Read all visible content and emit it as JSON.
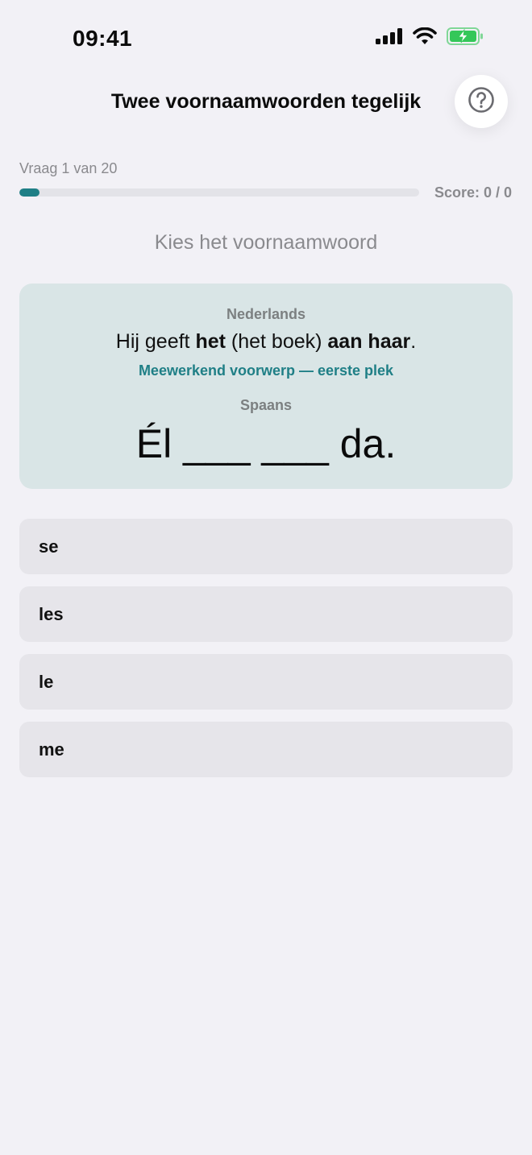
{
  "status_bar": {
    "time": "09:41",
    "icons": [
      "cellular-signal-icon",
      "wifi-icon",
      "battery-charging-icon"
    ],
    "battery_color": "#34c759"
  },
  "header": {
    "title": "Twee voornaamwoorden tegelijk",
    "help_icon": "question-mark-icon"
  },
  "progress": {
    "label": "Vraag 1 van 20",
    "fraction": 0.05,
    "score": "Score: 0 / 0"
  },
  "instruction": "Kies het voornaamwoord",
  "card": {
    "source_language": "Nederlands",
    "source_sentence": {
      "p1": "Hij geeft ",
      "b1": "het",
      "p2": " (het boek) ",
      "b2": "aan haar",
      "p3": "."
    },
    "hint": "Meewerkend voorwerp — eerste plek",
    "target_language": "Spaans",
    "target_sentence": "Él ___ ___ da."
  },
  "options": [
    {
      "label": "se"
    },
    {
      "label": "les"
    },
    {
      "label": "le"
    },
    {
      "label": "me"
    }
  ],
  "colors": {
    "accent": "#1f7f86",
    "background": "#f2f1f6",
    "card_background": "#d9e5e6",
    "option_background": "#e6e5ea"
  }
}
